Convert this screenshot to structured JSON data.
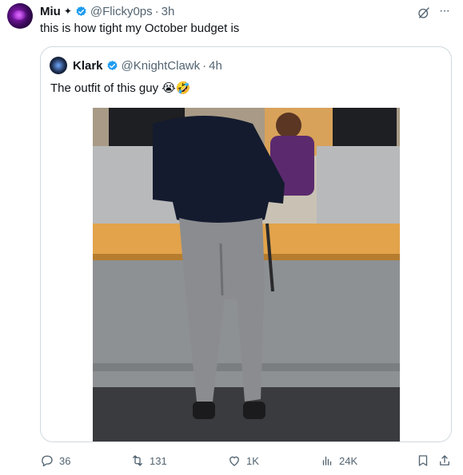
{
  "tweet": {
    "author_name": "Miu",
    "author_handle": "@Flicky0ps",
    "time": "3h",
    "text": "this is how tight my October budget is"
  },
  "quote": {
    "author_name": "Klark",
    "author_handle": "@KnightClawk",
    "time": "4h",
    "text": "The outfit of this guy 😭🤣"
  },
  "actions": {
    "replies": "36",
    "reposts": "131",
    "likes": "1K",
    "views": "24K"
  },
  "colors": {
    "verified": "#1d9bf0",
    "muted_text": "#536471",
    "border": "#cfd9de"
  },
  "icons": [
    "sparkle-icon",
    "verified-badge-icon",
    "grok-icon",
    "more-icon",
    "reply-icon",
    "repost-icon",
    "like-icon",
    "views-icon",
    "bookmark-icon",
    "share-icon"
  ]
}
